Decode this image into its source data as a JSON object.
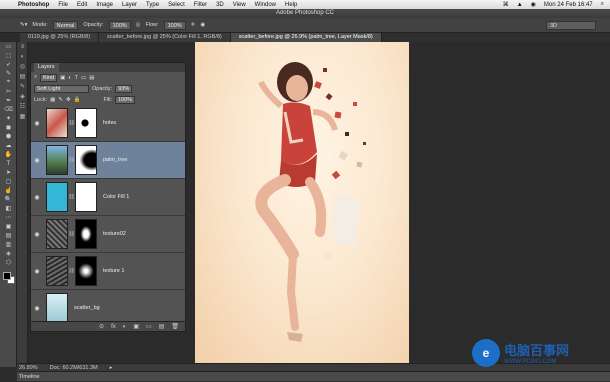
{
  "menubar": {
    "apple": "",
    "app": "Photoshop",
    "items": [
      "File",
      "Edit",
      "Image",
      "Layer",
      "Type",
      "Select",
      "Filter",
      "3D",
      "View",
      "Window",
      "Help"
    ],
    "clock": "Mon 24 Feb  16:47",
    "status_icons": [
      "⌘",
      "▲",
      "◉"
    ]
  },
  "window_title": "Adobe Photoshop CC",
  "options": {
    "mode_label": "Mode:",
    "mode_value": "Normal",
    "opacity_label": "Opacity:",
    "opacity_value": "100%",
    "flow_label": "Flow:",
    "flow_value": "100%",
    "workspace": "3D"
  },
  "doc_tabs": [
    {
      "label": "0119.jpg @ 25% (RGB/8)"
    },
    {
      "label": "scatter_before.jpg @ 25% (Color Fill 1, RGB/8)"
    },
    {
      "label": "scatter_before.jpg @ 26.9% (palm_tree, Layer Mask/8)"
    }
  ],
  "layers_panel": {
    "title": "Layers",
    "filter_kind": "Kind",
    "blend_mode": "Soft Light",
    "opacity_label": "Opacity:",
    "opacity_value": "93%",
    "lock_label": "Lock:",
    "fill_label": "Fill:",
    "fill_value": "100%",
    "layers": [
      {
        "name": "holes",
        "thumb": "linear-gradient(135deg,#e8d8c6,#c9564a 50%,#f0e2d2)",
        "mask": "radial-gradient(circle at 45% 50%,#000 18%,#fff 22%)",
        "selected": false
      },
      {
        "name": "palm_tree",
        "thumb": "linear-gradient(#7fb5e2,#4f7a4a 60%,#2e3e2b)",
        "mask": "radial-gradient(ellipse at 80% 50%,#000 35%,#fff 55%)",
        "selected": true
      },
      {
        "name": "Color Fill 1",
        "thumb": "#33b7d6",
        "mask": "#ffffff",
        "selected": false
      },
      {
        "name": "texture02",
        "thumb": "repeating-linear-gradient(45deg,#777 0 2px,#333 2px 4px)",
        "mask": "radial-gradient(ellipse at 50% 50%,#fff 18%,#000 40%)",
        "selected": false
      },
      {
        "name": "texture 1",
        "thumb": "repeating-linear-gradient(-30deg,#6a6a6a 0 2px,#2a2a2a 2px 4px)",
        "mask": "radial-gradient(circle at 50% 50%,#fff 10%,#000 45%)",
        "selected": false
      },
      {
        "name": "scatter_bg",
        "thumb": "linear-gradient(#d7f0f4,#9cc8d4)",
        "mask": "",
        "selected": false
      }
    ],
    "footer_icons": [
      "⊝",
      "fx",
      "◐",
      "▣",
      "▭",
      "▤",
      "🗑"
    ]
  },
  "status": {
    "zoom": "26.89%",
    "doc": "Doc: 60.2M/631.3M"
  },
  "timeline": "Timeline",
  "watermark": {
    "logo": "e",
    "line1": "电脑百事网",
    "line2": "WWW.PC841.COM"
  },
  "tools": [
    "▭",
    "⬚",
    "➶",
    "✎",
    "⌖",
    "✂",
    "✒",
    "⌫",
    "✦",
    "◼",
    "⬢",
    "☁",
    "✋",
    "T",
    "➤",
    "▢",
    "☝",
    "🔍",
    "◧",
    "⋯",
    "▣",
    "▤",
    "▥",
    "◈",
    "⬡"
  ],
  "dock_icons": [
    "≡",
    "◐",
    "◎",
    "▤",
    "✎",
    "◈",
    "☷",
    "▦"
  ]
}
